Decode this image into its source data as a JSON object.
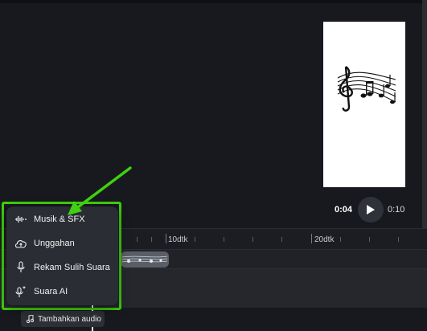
{
  "player": {
    "current_time": "0:04",
    "total_time": "0:10"
  },
  "timeline": {
    "labels": [
      "10dtk",
      "20dtk"
    ]
  },
  "audio_menu": {
    "items": [
      {
        "label": "Musik & SFX",
        "icon": "waveform-icon"
      },
      {
        "label": "Unggahan",
        "icon": "cloud-upload-icon"
      },
      {
        "label": "Rekam Sulih Suara",
        "icon": "microphone-icon"
      },
      {
        "label": "Suara AI",
        "icon": "ai-voice-icon"
      }
    ]
  },
  "add_audio_button": {
    "label": "Tambahkan audio"
  },
  "colors": {
    "highlight": "#3fd10f",
    "background": "#17191e",
    "menu": "#2a2d33"
  }
}
